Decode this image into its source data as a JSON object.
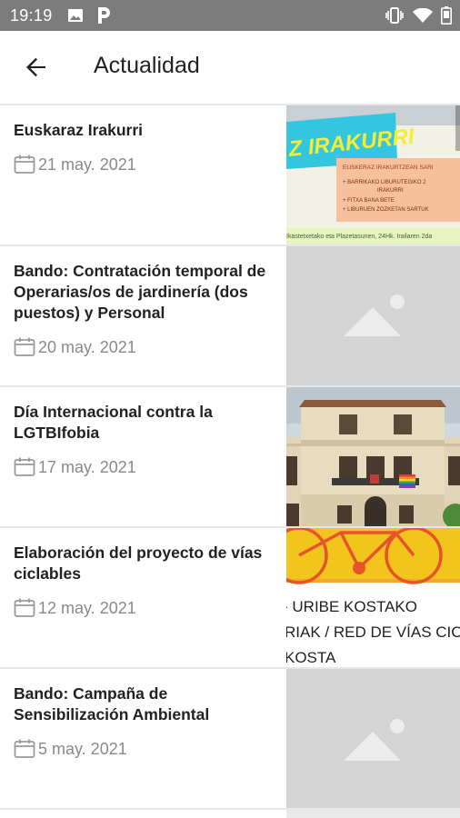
{
  "status_bar": {
    "time": "19:19"
  },
  "app_bar": {
    "title": "Actualidad",
    "back_icon": "arrow-back-icon"
  },
  "news": [
    {
      "title": "Euskaraz Irakurri",
      "date": "21 may. 2021",
      "thumbnail": "image"
    },
    {
      "title": "Bando: Contratación temporal de Operarias/os de jardinería (dos puestos) y Personal",
      "date": "20 may. 2021",
      "thumbnail": "placeholder"
    },
    {
      "title": "Día Internacional contra la LGTBIfobia",
      "date": "17 may. 2021",
      "thumbnail": "image"
    },
    {
      "title": "Elaboración del proyecto de vías ciclables",
      "date": "12 may. 2021",
      "thumbnail": "image"
    },
    {
      "title": "Bando: Campaña de Sensibilización Ambiental",
      "date": "5 may. 2021",
      "thumbnail": "placeholder"
    }
  ],
  "thumbs": {
    "poster1": {
      "heading": "Z IRAKURRI",
      "box_title": "EUSKERAZ IRAKURTZEAN SARI",
      "lines": [
        "+ BARRIKAKO LIBURUTEGIKO 2",
        "IRAKURRI",
        "+ FITXA BANA BETE",
        "+ LIBURUEN ZOZKETAN SARTUK"
      ],
      "footer": "Ikastetxetako eta Plazetasunen, 24Hk. Irailaren 2da"
    },
    "bike": {
      "lines": [
        "- URIBE KOSTAKO",
        "RIAK / RED DE VÍAS CIC",
        "KOSTA"
      ]
    }
  },
  "colors": {
    "status_bar": "#7c7c7c",
    "divider": "#e4e8eb",
    "placeholder": "#d4d4d4",
    "date_text": "#8a8a8a"
  }
}
